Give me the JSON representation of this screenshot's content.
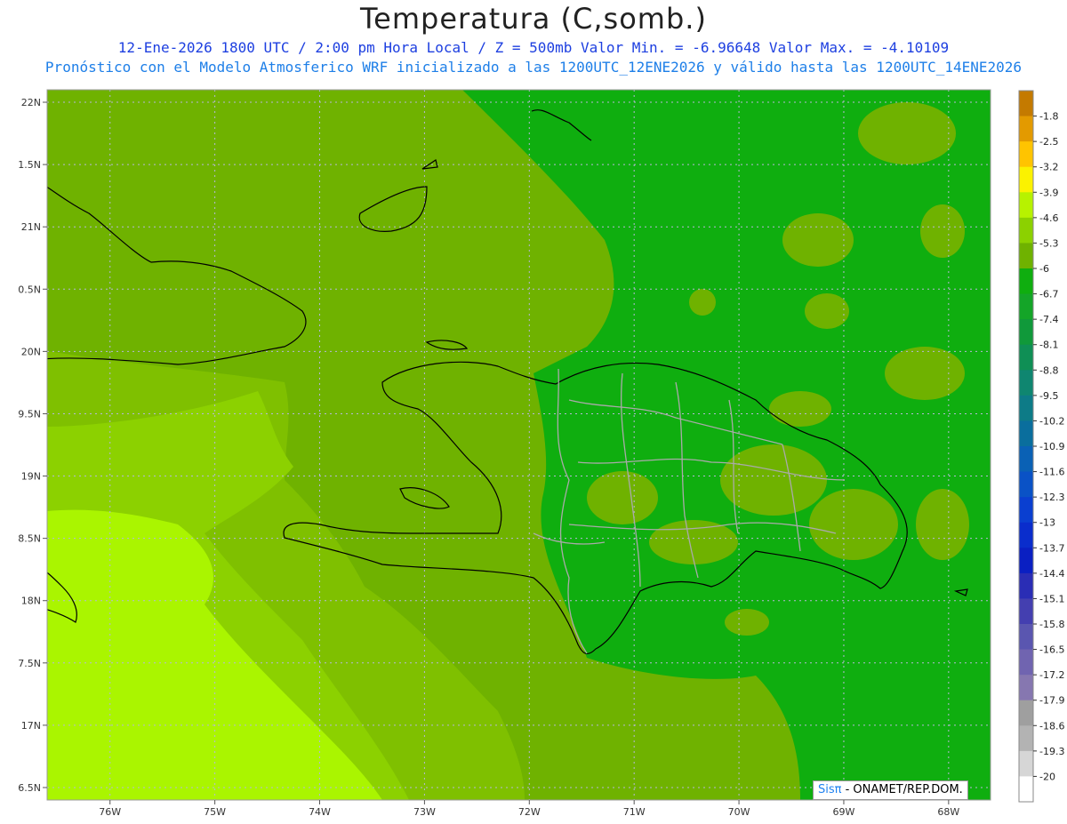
{
  "title": "Temperatura (C,somb.)",
  "subtitle_line1": "12-Ene-2026  1800 UTC / 2:00 pm Hora Local / Z = 500mb  Valor Min. = -6.96648  Valor Max. = -4.10109",
  "subtitle_line2": "Pronóstico con el Modelo Atmosferico WRF inicializado a las 1200UTC_12ENE2026 y válido hasta las  1200UTC_14ENE2026",
  "credit": {
    "brand": "Sisπ",
    "text": " - ONAMET/REP.DOM."
  },
  "map": {
    "lon_range": [
      -76.6,
      -67.6
    ],
    "lat_range": [
      16.4,
      22.1
    ],
    "lon_ticks": [
      "76W",
      "75W",
      "74W",
      "73W",
      "72W",
      "71W",
      "70W",
      "69W",
      "68W"
    ],
    "lat_ticks": [
      "22N",
      "1.5N",
      "21N",
      "0.5N",
      "20N",
      "9.5N",
      "19N",
      "8.5N",
      "18N",
      "7.5N",
      "17N",
      "6.5N"
    ],
    "field_colors": {
      "lightest": "#aaf500",
      "light": "#8cd100",
      "medium_light": "#7fc000",
      "medium": "#6fb200",
      "dark": "#0fae0f"
    }
  },
  "colorbar": {
    "labels": [
      "-1.8",
      "-2.5",
      "-3.2",
      "-3.9",
      "-4.6",
      "-5.3",
      "-6",
      "-6.7",
      "-7.4",
      "-8.1",
      "-8.8",
      "-9.5",
      "-10.2",
      "-10.9",
      "-11.6",
      "-12.3",
      "-13",
      "-13.7",
      "-14.4",
      "-15.1",
      "-15.8",
      "-16.5",
      "-17.2",
      "-17.9",
      "-18.6",
      "-19.3",
      "-20"
    ],
    "colors": [
      "#c47a00",
      "#e39a00",
      "#ffc400",
      "#fbf200",
      "#b7f200",
      "#8cd100",
      "#6fb200",
      "#0fae0f",
      "#14a528",
      "#10993a",
      "#0f8f55",
      "#0f8670",
      "#0d7b87",
      "#0a6e9d",
      "#0a61b5",
      "#0a52c6",
      "#0a3fd0",
      "#0a2dcc",
      "#0a1fc2",
      "#2a2db5",
      "#443fb0",
      "#5a56b0",
      "#7064b0",
      "#8677b0",
      "#9f9f9f",
      "#b3b3b3",
      "#d6d6d6",
      "#ffffff"
    ]
  }
}
